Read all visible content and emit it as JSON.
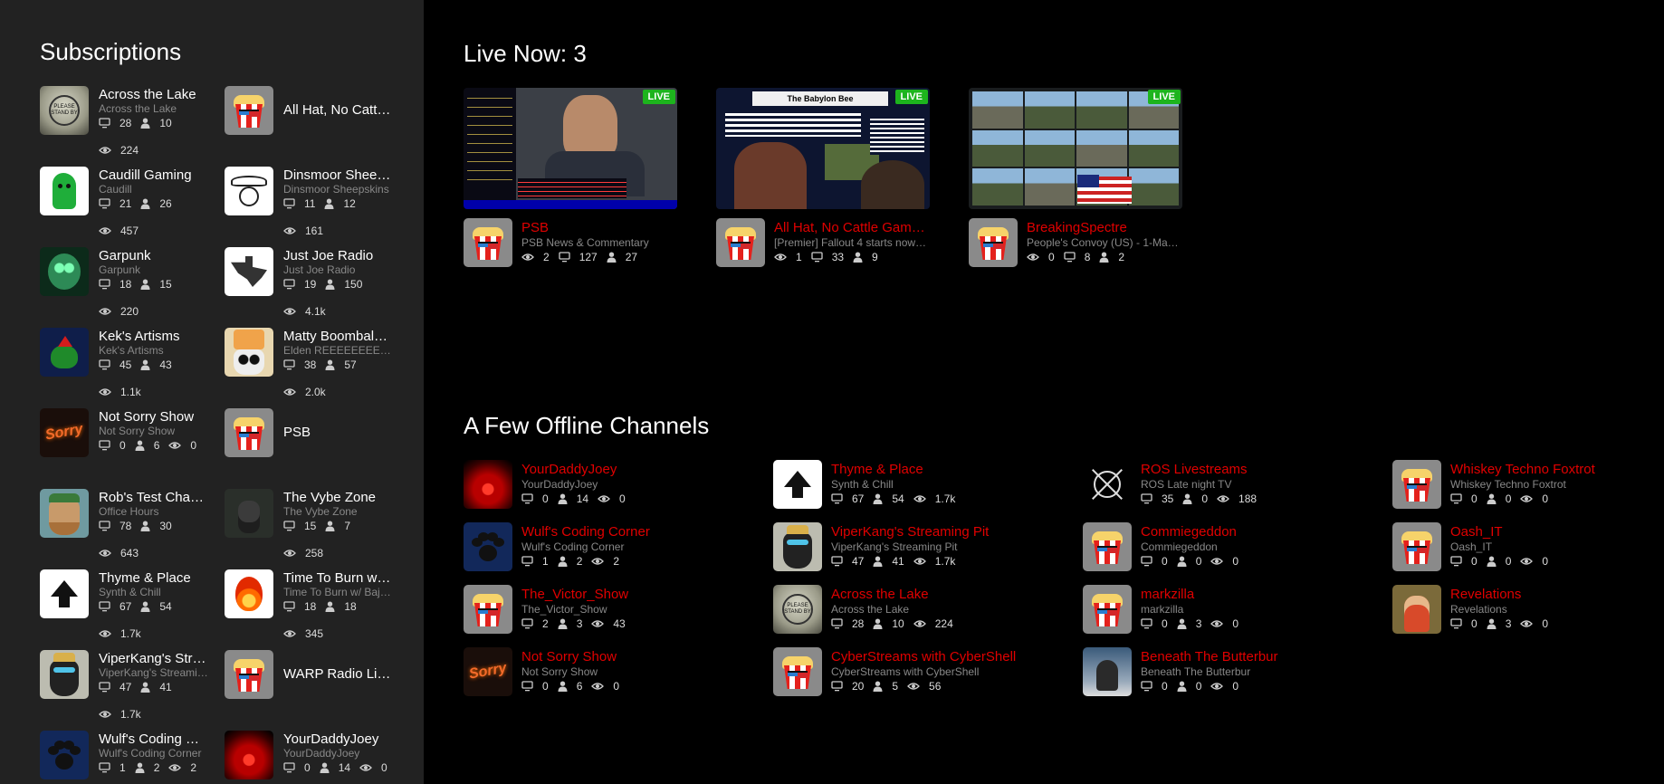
{
  "sidebar": {
    "title": "Subscriptions",
    "items": [
      {
        "name": "Across the Lake",
        "sub": "Across the Lake",
        "screens": "28",
        "users": "10",
        "views": "224",
        "avatar": "standby"
      },
      {
        "name": "All Hat, No Catt…",
        "avatar": "popcorn"
      },
      {
        "name": "Caudill Gaming",
        "sub": "Caudill",
        "screens": "21",
        "users": "26",
        "views": "457",
        "avatar": "gumby"
      },
      {
        "name": "Dinsmoor Shee…",
        "sub": "Dinsmoor Sheepskins",
        "screens": "11",
        "users": "12",
        "views": "161",
        "avatar": "cowboy"
      },
      {
        "name": "Garpunk",
        "sub": "Garpunk",
        "screens": "18",
        "users": "15",
        "views": "220",
        "avatar": "gasmask"
      },
      {
        "name": "Just Joe Radio",
        "sub": "Just Joe Radio",
        "screens": "19",
        "users": "150",
        "views": "4.1k",
        "avatar": "texas"
      },
      {
        "name": "Kek's Artisms",
        "sub": "Kek's Artisms",
        "screens": "45",
        "users": "43",
        "views": "1.1k",
        "avatar": "kek"
      },
      {
        "name": "Matty Boombal…",
        "sub": "Elden REEEEEEEE…",
        "screens": "38",
        "users": "57",
        "views": "2.0k",
        "avatar": "skull"
      },
      {
        "name": "Not Sorry Show",
        "sub": "Not Sorry Show",
        "screens": "0",
        "users": "6",
        "views": "0",
        "avatar": "notsorry",
        "inline": true
      },
      {
        "name": "PSB",
        "avatar": "popcorn"
      },
      {
        "name": "Rob's Test Cha…",
        "sub": "Office Hours",
        "screens": "78",
        "users": "30",
        "views": "643",
        "avatar": "rob"
      },
      {
        "name": "The Vybe Zone",
        "sub": "The Vybe Zone",
        "screens": "15",
        "users": "7",
        "views": "258",
        "avatar": "vybe"
      },
      {
        "name": "Thyme & Place",
        "sub": "Synth & Chill",
        "screens": "67",
        "users": "54",
        "views": "1.7k",
        "avatar": "thyme"
      },
      {
        "name": "Time To Burn w…",
        "sub": "Time To Burn w/ Baj…",
        "screens": "18",
        "users": "18",
        "views": "345",
        "avatar": "fire"
      },
      {
        "name": "ViperKang's Str…",
        "sub": "ViperKang's Streami…",
        "screens": "47",
        "users": "41",
        "views": "1.7k",
        "avatar": "viper"
      },
      {
        "name": "WARP Radio Li…",
        "avatar": "popcorn"
      },
      {
        "name": "Wulf's Coding …",
        "sub": "Wulf's Coding Corner",
        "screens": "1",
        "users": "2",
        "views": "2",
        "avatar": "paw",
        "inline": true
      },
      {
        "name": "YourDaddyJoey",
        "sub": "YourDaddyJoey",
        "screens": "0",
        "users": "14",
        "views": "0",
        "avatar": "sunset",
        "inline": true
      }
    ]
  },
  "live": {
    "title": "Live Now: 3",
    "badge": "LIVE",
    "cards": [
      {
        "name": "PSB",
        "desc": "PSB News & Commentary",
        "views": "2",
        "screens": "127",
        "users": "27",
        "thumb": "psb"
      },
      {
        "name": "All Hat, No Cattle Gam…",
        "desc": "[Premier] Fallout 4 starts now…",
        "views": "1",
        "screens": "33",
        "users": "9",
        "thumb": "bee"
      },
      {
        "name": "BreakingSpectre",
        "desc": "People's Convoy (US) - 1-Ma…",
        "views": "0",
        "screens": "8",
        "users": "2",
        "thumb": "convoy"
      }
    ]
  },
  "offline": {
    "title": "A Few Offline Channels",
    "items": [
      {
        "name": "YourDaddyJoey",
        "sub": "YourDaddyJoey",
        "screens": "0",
        "users": "14",
        "views": "0",
        "avatar": "sunset"
      },
      {
        "name": "Thyme & Place",
        "sub": "Synth & Chill",
        "screens": "67",
        "users": "54",
        "views": "1.7k",
        "avatar": "thyme"
      },
      {
        "name": "ROS Livestreams",
        "sub": "ROS Late night TV",
        "screens": "35",
        "users": "0",
        "views": "188",
        "avatar": "ros"
      },
      {
        "name": "Whiskey Techno Foxtrot",
        "sub": "Whiskey Techno Foxtrot",
        "screens": "0",
        "users": "0",
        "views": "0",
        "avatar": "popcorn"
      },
      {
        "name": "Wulf's Coding Corner",
        "sub": "Wulf's Coding Corner",
        "screens": "1",
        "users": "2",
        "views": "2",
        "avatar": "paw"
      },
      {
        "name": "ViperKang's Streaming Pit",
        "sub": "ViperKang's Streaming Pit",
        "screens": "47",
        "users": "41",
        "views": "1.7k",
        "avatar": "viper"
      },
      {
        "name": "Commiegeddon",
        "sub": "Commiegeddon",
        "screens": "0",
        "users": "0",
        "views": "0",
        "avatar": "popcorn"
      },
      {
        "name": "Oash_IT",
        "sub": "Oash_IT",
        "screens": "0",
        "users": "0",
        "views": "0",
        "avatar": "popcorn"
      },
      {
        "name": "The_Victor_Show",
        "sub": "The_Victor_Show",
        "screens": "2",
        "users": "3",
        "views": "43",
        "avatar": "popcorn"
      },
      {
        "name": "Across the Lake",
        "sub": "Across the Lake",
        "screens": "28",
        "users": "10",
        "views": "224",
        "avatar": "standby"
      },
      {
        "name": "markzilla",
        "sub": "markzilla",
        "screens": "0",
        "users": "3",
        "views": "0",
        "avatar": "popcorn"
      },
      {
        "name": "Revelations",
        "sub": "Revelations",
        "screens": "0",
        "users": "3",
        "views": "0",
        "avatar": "revelations"
      },
      {
        "name": "Not Sorry Show",
        "sub": "Not Sorry Show",
        "screens": "0",
        "users": "6",
        "views": "0",
        "avatar": "notsorry"
      },
      {
        "name": "CyberStreams with CyberShell",
        "sub": "CyberStreams with CyberShell",
        "screens": "20",
        "users": "5",
        "views": "56",
        "avatar": "popcorn"
      },
      {
        "name": "Beneath The Butterbur",
        "sub": "Beneath The Butterbur",
        "screens": "0",
        "users": "0",
        "views": "0",
        "avatar": "butterbur"
      }
    ]
  },
  "colors": {
    "accent": "#e00000",
    "sidebar_bg": "#222222",
    "main_bg": "#000000",
    "live_badge": "#1db41d"
  }
}
